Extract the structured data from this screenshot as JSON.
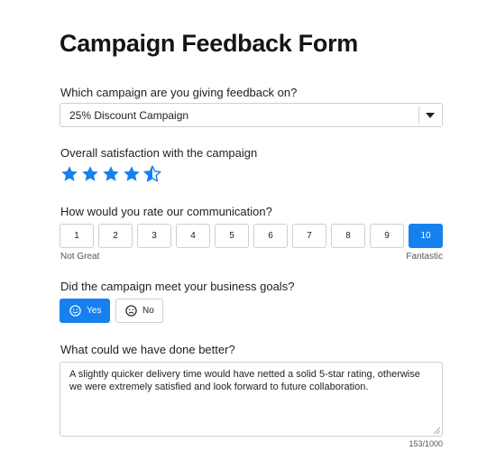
{
  "page": {
    "title": "Campaign Feedback Form"
  },
  "campaign": {
    "label": "Which campaign are you giving feedback on?",
    "selected": "25% Discount Campaign"
  },
  "satisfaction": {
    "label": "Overall satisfaction with the campaign",
    "rating": 4.5,
    "max": 5,
    "color": "#1681ee"
  },
  "communication": {
    "label": "How would you rate our communication?",
    "options": [
      "1",
      "2",
      "3",
      "4",
      "5",
      "6",
      "7",
      "8",
      "9",
      "10"
    ],
    "selected": "10",
    "low_label": "Not Great",
    "high_label": "Fantastic"
  },
  "goals": {
    "label": "Did the campaign meet your business goals?",
    "yes_label": "Yes",
    "no_label": "No",
    "selected": "Yes"
  },
  "improve": {
    "label": "What could we have done better?",
    "value": "A slightly quicker delivery time would have netted a solid 5-star rating, otherwise we were extremely satisfied and look forward to future collaboration.",
    "counter": "153/1000"
  },
  "colors": {
    "accent": "#1681ee",
    "border": "#cfcfcf"
  },
  "icons": {
    "select_caret": "caret-down-icon",
    "star": "star-icon",
    "yes": "smile-icon",
    "no": "frown-icon"
  }
}
